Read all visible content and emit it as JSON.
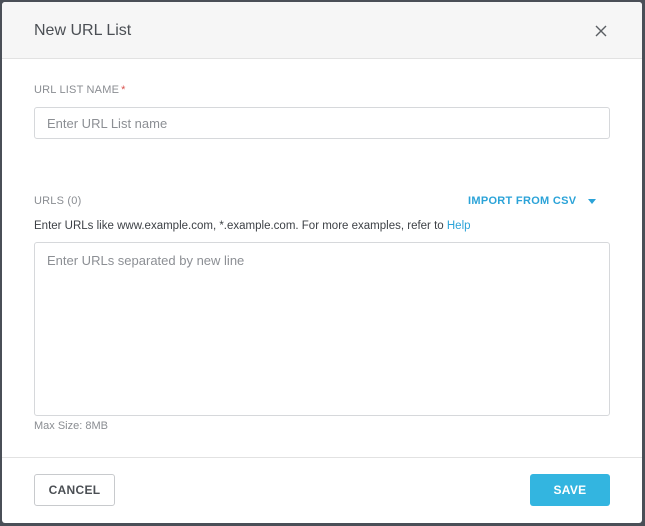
{
  "dialog": {
    "title": "New URL List",
    "close_icon": "close-icon"
  },
  "name_field": {
    "label": "URL LIST NAME",
    "required_mark": "*",
    "placeholder": "Enter URL List name",
    "value": ""
  },
  "urls_field": {
    "label": "URLS (0)",
    "import_label": "IMPORT FROM CSV",
    "import_icon": "caret-down-icon",
    "hint_text": "Enter URLs like www.example.com, *.example.com. For more examples, refer to ",
    "help_link": "Help",
    "placeholder": "Enter URLs separated by new line",
    "value": "",
    "max_size": "Max Size: 8MB"
  },
  "footer": {
    "cancel_label": "CANCEL",
    "save_label": "SAVE"
  },
  "colors": {
    "accent": "#2ba3d8",
    "save_button": "#33b5e0",
    "required": "#d9534f",
    "header_bg": "#f6f6f6"
  }
}
